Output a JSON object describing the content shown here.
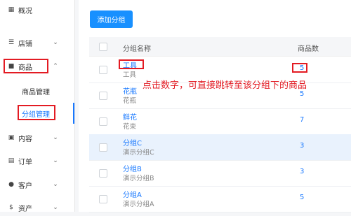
{
  "sidebar": {
    "items": [
      {
        "icon": "dashboard-icon",
        "label": "概况"
      },
      {
        "icon": "store-icon",
        "label": "店铺"
      },
      {
        "icon": "goods-icon",
        "label": "商品"
      },
      {
        "sub": "商品管理"
      },
      {
        "sub": "分组管理"
      },
      {
        "icon": "content-icon",
        "label": "内容"
      },
      {
        "icon": "order-icon",
        "label": "订单"
      },
      {
        "icon": "customer-icon",
        "label": "客户"
      },
      {
        "icon": "asset-icon",
        "label": "资产"
      }
    ]
  },
  "toolbar": {
    "add_label": "添加分组"
  },
  "table": {
    "headers": [
      "分组名称",
      "商品数"
    ],
    "rows": [
      {
        "name": "工具",
        "desc": "工具",
        "count": "5"
      },
      {
        "name": "花瓶",
        "desc": "花瓶",
        "count": "5"
      },
      {
        "name": "鲜花",
        "desc": "花束",
        "count": "7"
      },
      {
        "name": "分组C",
        "desc": "演示分组C",
        "count": "3"
      },
      {
        "name": "分组B",
        "desc": "演示分组B",
        "count": "3"
      },
      {
        "name": "分组A",
        "desc": "演示分组A",
        "count": "5"
      }
    ]
  },
  "annotation": {
    "text": "点击数字，可直接跳转至该分组下的商品"
  },
  "colors": {
    "accent": "#1890ff",
    "highlight_row": "#e9f2fd",
    "annotation_red": "#e31b23"
  }
}
